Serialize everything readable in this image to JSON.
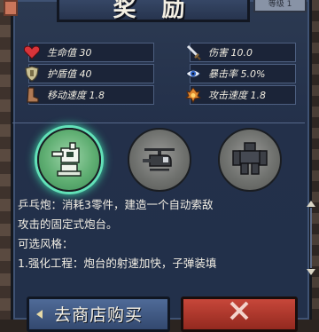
{
  "window": {
    "title": "奖 励",
    "badge": "等级 1"
  },
  "stats": [
    {
      "icon": "heart-icon",
      "label": "生命值 30"
    },
    {
      "icon": "shield-icon",
      "label": "护盾值 40"
    },
    {
      "icon": "boot-icon",
      "label": "移动速度 1.8"
    },
    {
      "icon": "sword-icon",
      "label": "伤害 10.0"
    },
    {
      "icon": "eye-icon",
      "label": "暴击率 5.0%"
    },
    {
      "icon": "flame-icon",
      "label": "攻击速度 1.8"
    }
  ],
  "items": [
    {
      "icon": "turret-icon",
      "selected": true
    },
    {
      "icon": "helicopter-icon",
      "selected": false
    },
    {
      "icon": "mech-robot-icon",
      "selected": false
    }
  ],
  "description": {
    "line1": "乒乓炮：消耗3零件，建造一个自动索敌",
    "line2": "攻击的固定式炮台。",
    "line3": "可选风格：",
    "line4": "1.强化工程：炮台的射速加快，子弹装填"
  },
  "buttons": {
    "shop": "去商店购买",
    "close_icon": "close-icon"
  },
  "colors": {
    "panel": "#23304a",
    "selected_glow": "#3fd6a6",
    "close": "#c7473a"
  }
}
